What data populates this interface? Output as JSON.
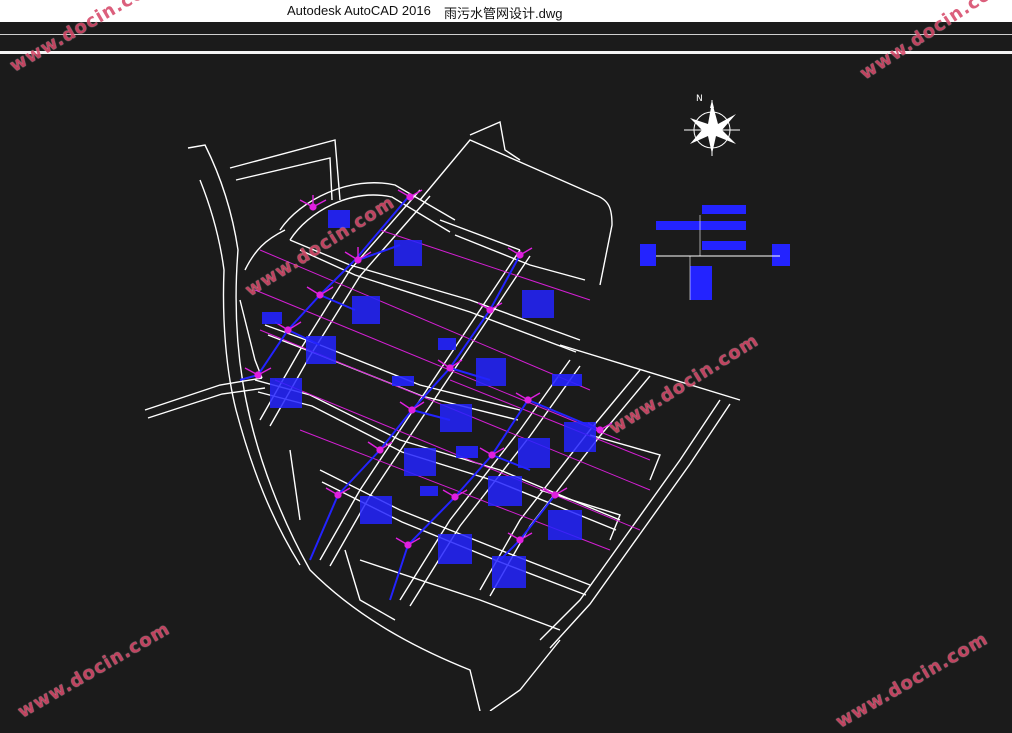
{
  "window": {
    "app_title": "Autodesk AutoCAD 2016",
    "file_name": "雨污水管网设计.dwg"
  },
  "compass": {
    "label": "N"
  },
  "watermark": {
    "text": "www.docin.com"
  },
  "colors": {
    "background": "#1b1b1b",
    "roads": "#ffffff",
    "pipes": "#2323ff",
    "arrows": "#e020e0"
  }
}
